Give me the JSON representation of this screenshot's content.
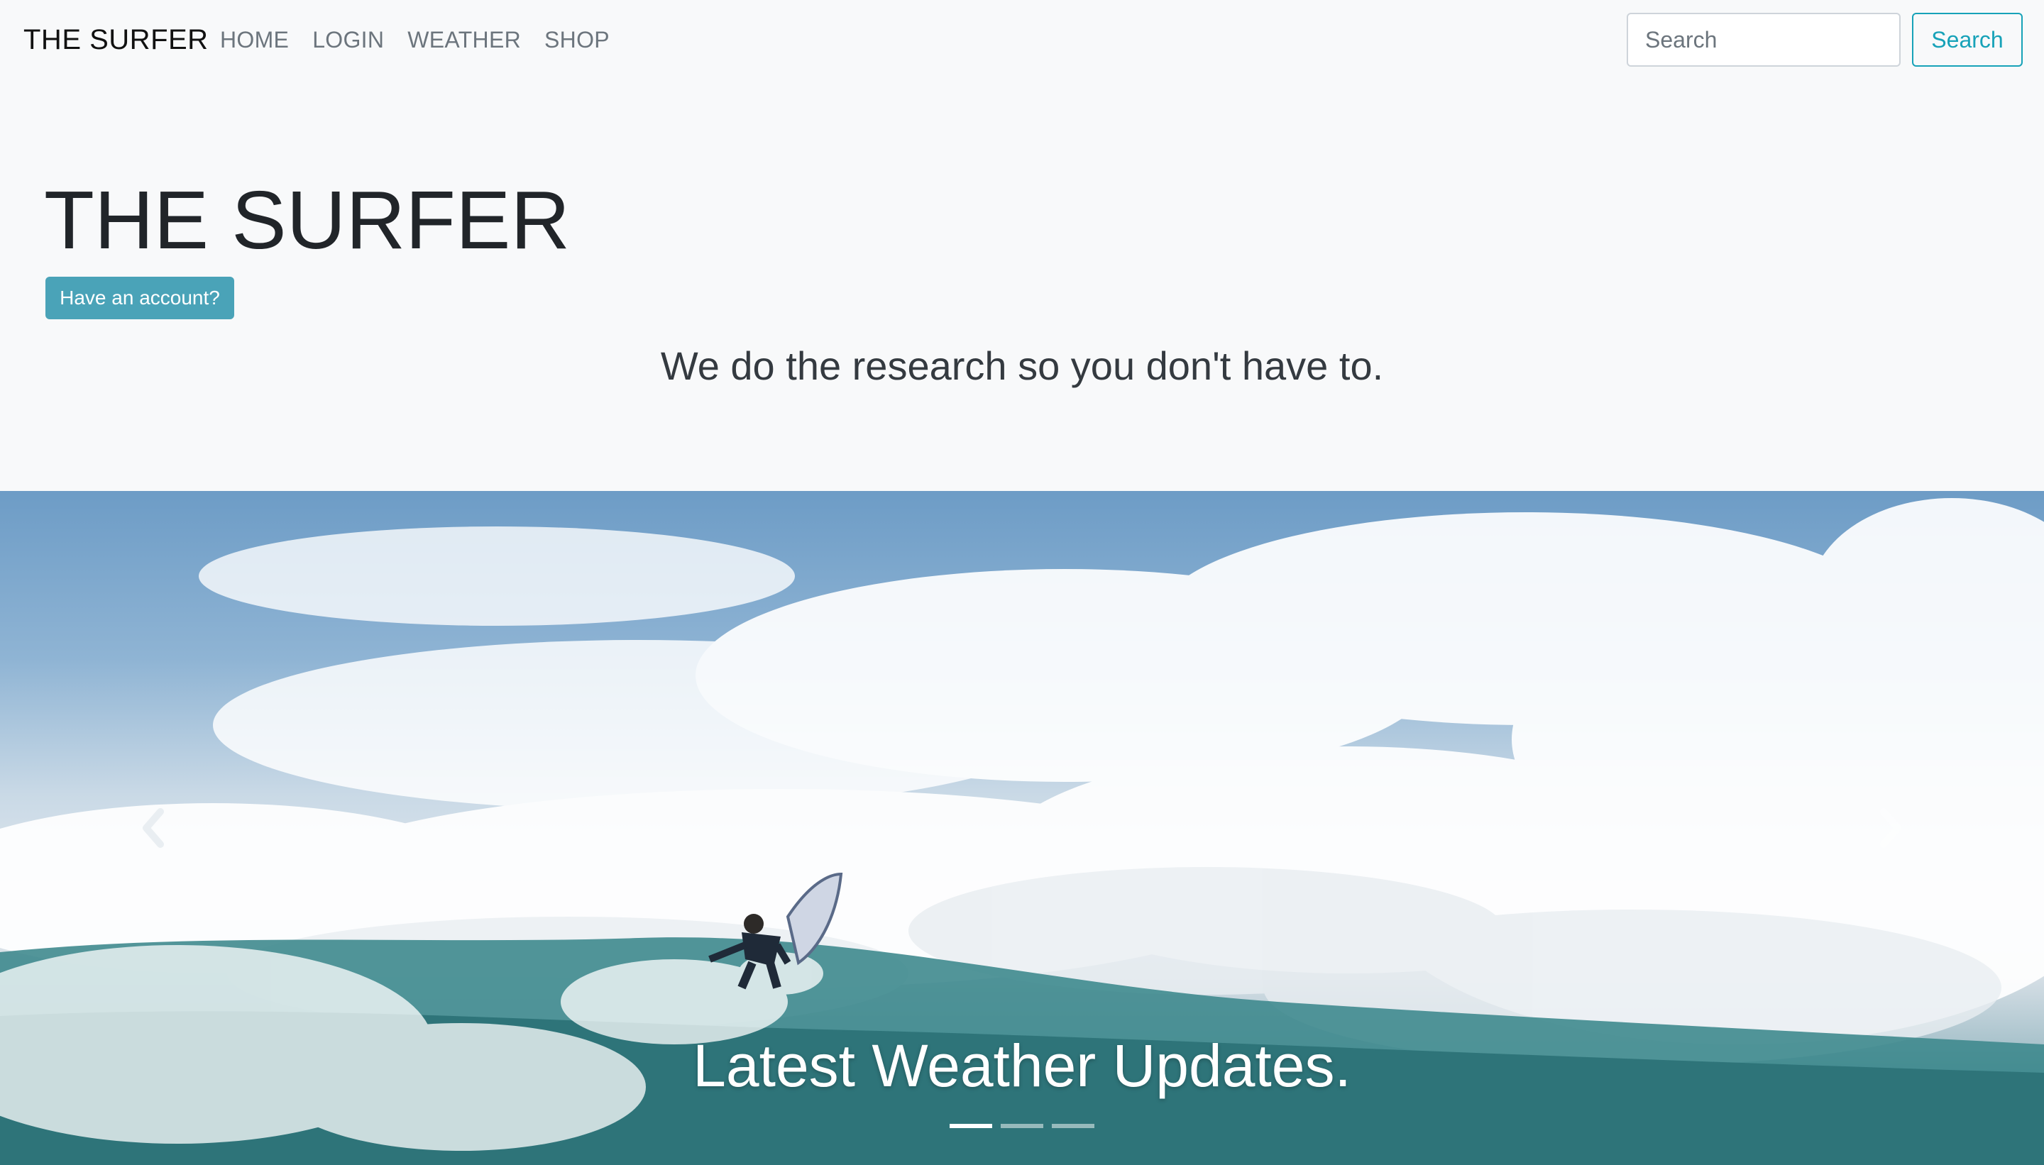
{
  "navbar": {
    "brand": "THE SURFER",
    "links": [
      "HOME",
      "LOGIN",
      "WEATHER",
      "SHOP"
    ],
    "search_placeholder": "Search",
    "search_button": "Search"
  },
  "hero": {
    "title": "THE SURFER",
    "account_button": "Have an account?",
    "tagline": "We do the research so you don't have to."
  },
  "carousel": {
    "caption": "Latest Weather Updates.",
    "slide_count": 3,
    "active_slide": 1,
    "icons": {
      "prev": "chevron-left-icon",
      "next": "chevron-right-icon"
    }
  },
  "colors": {
    "background": "#f8f9fa",
    "accent": "#17a2b8",
    "account_button_bg": "#4aa3b8",
    "text_dark": "#212529",
    "nav_text": "#6c757d"
  }
}
